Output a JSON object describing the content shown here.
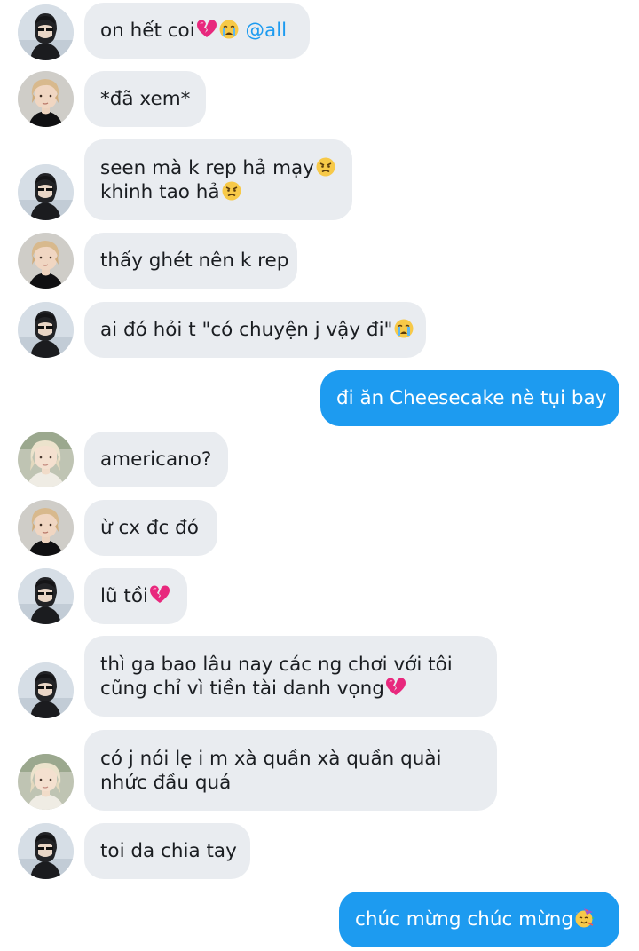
{
  "colors": {
    "incoming_bubble": "#e9ecf0",
    "outgoing_bubble": "#1d9bf0",
    "mention": "#1d9bf0",
    "text_dark": "#1a1d21"
  },
  "messages": [
    {
      "sender": "avatar-a",
      "direction": "in",
      "lines": [
        {
          "text": "on hết coi",
          "emoji": [
            "broken-heart-icon",
            "crying-face-icon"
          ],
          "mention": "@all"
        }
      ]
    },
    {
      "sender": "avatar-b",
      "direction": "in",
      "lines": [
        {
          "text": "*đã xem*"
        }
      ]
    },
    {
      "sender": "avatar-a",
      "direction": "in",
      "lines": [
        {
          "text": "seen mà k rep hả mạy",
          "emoji": [
            "angry-face-icon"
          ]
        },
        {
          "text": "khinh tao hả",
          "emoji": [
            "angry-face-icon"
          ]
        }
      ]
    },
    {
      "sender": "avatar-b",
      "direction": "in",
      "lines": [
        {
          "text": "thấy ghét nên k rep"
        }
      ]
    },
    {
      "sender": "avatar-a",
      "direction": "in",
      "lines": [
        {
          "text": "ai đó hỏi t \"có chuyện j vậy đi\"",
          "emoji": [
            "crying-face-icon"
          ]
        }
      ]
    },
    {
      "sender": "me",
      "direction": "out",
      "lines": [
        {
          "text": "đi ăn Cheesecake nè tụi bay"
        }
      ]
    },
    {
      "sender": "avatar-c",
      "direction": "in",
      "lines": [
        {
          "text": "americano?"
        }
      ]
    },
    {
      "sender": "avatar-b",
      "direction": "in",
      "lines": [
        {
          "text": "ừ cx đc đó"
        }
      ]
    },
    {
      "sender": "avatar-a",
      "direction": "in",
      "lines": [
        {
          "text": "lũ tồi",
          "emoji": [
            "broken-heart-icon"
          ]
        }
      ]
    },
    {
      "sender": "avatar-a",
      "direction": "in",
      "lines": [
        {
          "text": "thì ga bao lâu nay các ng chơi với tôi"
        },
        {
          "text": "cũng chỉ vì tiền tài danh vọng",
          "emoji": [
            "broken-heart-icon"
          ]
        }
      ]
    },
    {
      "sender": "avatar-c",
      "direction": "in",
      "lines": [
        {
          "text": "có j nói lẹ i m xà quần xà quần quài"
        },
        {
          "text": "nhức đầu quá"
        }
      ]
    },
    {
      "sender": "avatar-a",
      "direction": "in",
      "lines": [
        {
          "text": "toi da chia tay"
        }
      ]
    },
    {
      "sender": "me",
      "direction": "out",
      "lines": [
        {
          "text": "chúc mừng chúc mừng",
          "emoji": [
            "party-face-icon"
          ]
        }
      ]
    }
  ]
}
